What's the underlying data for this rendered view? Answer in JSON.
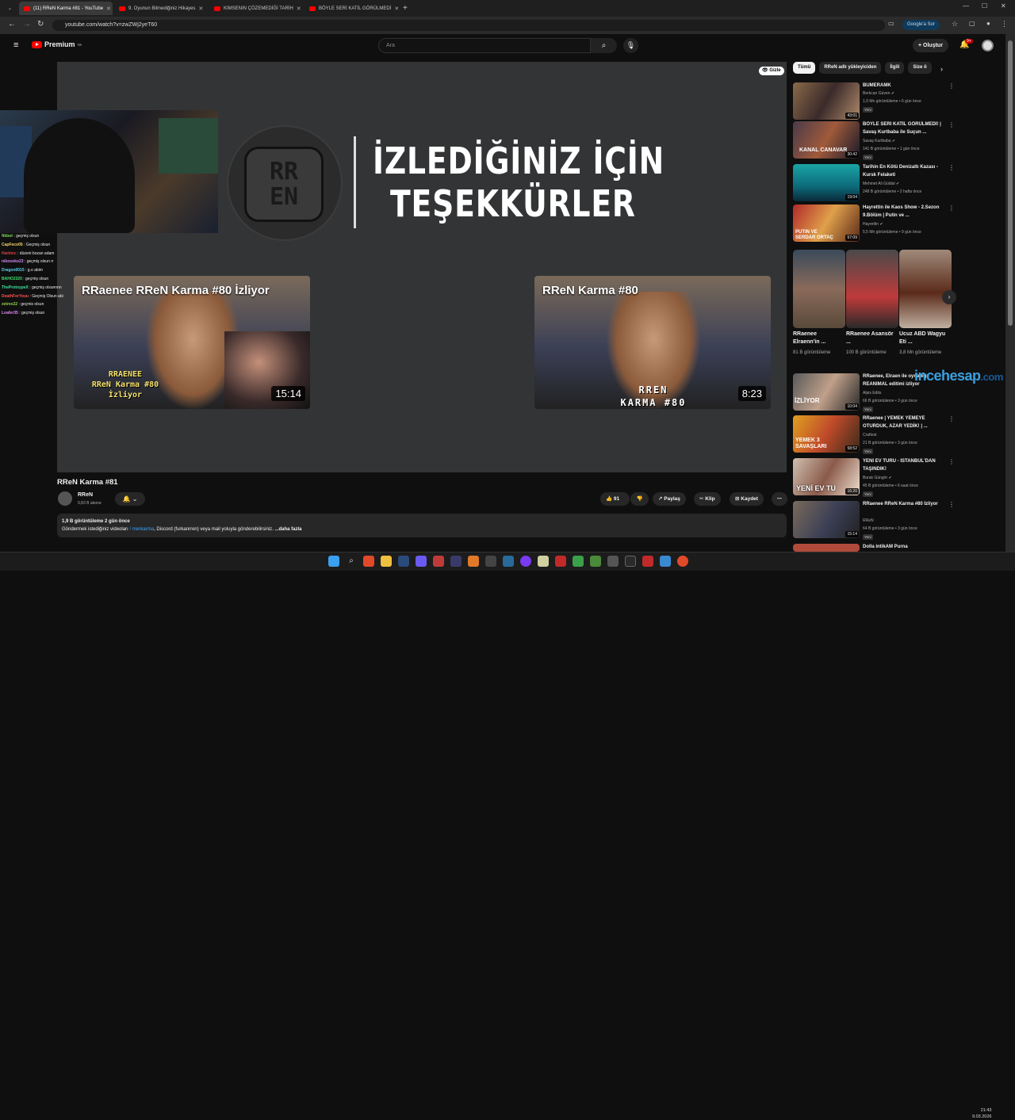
{
  "browser": {
    "tabs": [
      {
        "label": "(11) RReN Karma #81 - YouTube",
        "active": true
      },
      {
        "label": "9. Oyunun Bilmediğiniz Hikayes",
        "active": false
      },
      {
        "label": "KIMSENIN ÇÖZEMEDİĞİ TARİH",
        "active": false
      },
      {
        "label": "BÖYLE SERİ KATİL GÖRÜLMEDİ",
        "active": false
      }
    ],
    "url": "youtube.com/watch?v=zwZWj2yeT60",
    "google_btn": "Google'a Sor"
  },
  "header": {
    "logo": "Premium",
    "logo_badge": "TR",
    "search_placeholder": "Ara",
    "create_label": "Oluştur",
    "notif_count": "9+"
  },
  "player": {
    "thanks_line1": "İZLEDİĞİNİZ İÇİN",
    "thanks_line2": "TEŞEKKÜRLER",
    "logo_top": "RR",
    "logo_bottom": "EN",
    "hide_label": "Gizle",
    "endcard_left": {
      "title": "RRaenee RReN Karma #80 İzliyor",
      "overlay": [
        "RRAENEE",
        "RReN Karma #80",
        "İzliyor"
      ],
      "duration": "15:14"
    },
    "endcard_right": {
      "title": "RReN Karma #80",
      "overlay": [
        "RREN",
        "KARMA #80"
      ],
      "duration": "8:23"
    }
  },
  "chat": [
    {
      "user": "ftkbot",
      "msg": "geçmiş olsun",
      "color": "#7fdc5a"
    },
    {
      "user": "CapFeco05",
      "msg": "Geçmiş olsun",
      "color": "#f5d36a"
    },
    {
      "user": "Harbinc",
      "msg": "düzeni bozan adam",
      "color": "#e04040"
    },
    {
      "user": "nikosoko23",
      "msg": "geçmiş olsun rr",
      "color": "#d08af0"
    },
    {
      "user": "Dragon0015",
      "msg": "g.o abim",
      "color": "#5ad0f0"
    },
    {
      "user": "BAHO2320",
      "msg": "geçmiş olsun",
      "color": "#40e070"
    },
    {
      "user": "TheProtoypeX",
      "msg": "geçmiş olsunnnn",
      "color": "#40e0a0"
    },
    {
      "user": "DeathForYouu",
      "msg": "Geçmiş Olsun abi",
      "color": "#ff5050"
    },
    {
      "user": "zetrex22",
      "msg": "geçmis olsun",
      "color": "#9ad04a"
    },
    {
      "user": "Loafer35",
      "msg": "geçmiş olsun",
      "color": "#e08af0"
    }
  ],
  "video": {
    "title": "RReN Karma #81",
    "channel": "RReN",
    "subs": "9,83 B abone",
    "likes": "91",
    "share": "Paylaş",
    "clip": "Klip",
    "save": "Kaydet",
    "views_date": "1,9 B görüntüleme  2 gün önce",
    "desc_prefix": "Göndermek istediğiniz videoları",
    "desc_handle": "/ rrenkarma",
    "desc_rest": ", Discord (furkanrren) veya mail yoluyla gönderebilirsiniz.",
    "desc_more": "...daha fazla"
  },
  "sidebar": {
    "chips": [
      "Tümü",
      "RReN adlı yükleyiciden",
      "İlgili",
      "Size ö"
    ],
    "recs_top": [
      {
        "title": "BUMERAMK",
        "channel": "Berkcan Güven",
        "views": "1,9 Mn görüntüleme • 6 gün önce",
        "duration": "43:01",
        "badge": "Yeni",
        "verified": true
      },
      {
        "title": "BÖYLE SERİ KATİL GÖRÜLMEDİ! | Savaş Kurtbaba ile Suçun ...",
        "channel": "Savaş Kurtbaba",
        "views": "141 B görüntüleme • 1 gün önce",
        "duration": "30:42",
        "badge": "Yeni",
        "verified": true
      },
      {
        "title": "Tarihin En Kötü Denizaltı Kazası - Kursk Felaketi",
        "channel": "Mehmet Ali Güldal",
        "views": "248 B görüntüleme • 2 hafta önce",
        "duration": "19:04",
        "badge": "",
        "verified": true
      },
      {
        "title": "Hayrettin ile Kaos Show - 2.Sezon 9.Bölüm | Putin ve ...",
        "channel": "Hayrettin",
        "views": "5,5 Mn görüntüleme • 9 gün önce",
        "duration": "57:09",
        "badge": "",
        "verified": true
      }
    ],
    "shorts": [
      {
        "title": "RRaenee Elraenn'in ...",
        "views": "81 B görüntüleme"
      },
      {
        "title": "RRaenee Asansör ...",
        "views": "100 B görüntüleme"
      },
      {
        "title": "Ucuz ABD Wagyu Eti ...",
        "views": "3,8 Mn görüntüleme"
      }
    ],
    "recs_bottom": [
      {
        "title": "RRaenee, Elraen ile oynadığı REANIMAL editimi izliyor",
        "channel": "Alpis Edits",
        "views": "66 B görüntüleme • 3 gün önce",
        "duration": "10:04",
        "badge": "Yeni",
        "verified": false
      },
      {
        "title": "RRaenee | YEMEK YEMEYE OTURDUK, AZAR YEDİK! | ...",
        "channel": "Craftest",
        "views": "21 B görüntüleme • 3 gün önce",
        "duration": "58:52",
        "badge": "Yeni",
        "verified": false
      },
      {
        "title": "YENİ EV TURU - İSTANBUL'DAN TAŞINDIK!",
        "channel": "Burak Güngör",
        "views": "45 B görüntüleme • 6 saat önce",
        "duration": "16:20",
        "badge": "Yeni",
        "verified": true
      },
      {
        "title": "RRaenee RReN Karma #80 İzliyor",
        "channel": "RReN",
        "views": "64 B görüntüleme • 3 gün önce",
        "duration": "15:14",
        "badge": "Yeni",
        "verified": false
      },
      {
        "title": "Dolla intikAM Purna",
        "channel": "",
        "views": "",
        "duration": "",
        "badge": "",
        "verified": false
      }
    ],
    "watermark_a": "incehesap",
    "watermark_b": ".com"
  },
  "taskbar": {
    "time": "21:43",
    "date": "9.03.2026"
  },
  "colors": {
    "accent_red": "#ff0000",
    "bg": "#0f0f0f",
    "chip_bg": "#272727"
  }
}
